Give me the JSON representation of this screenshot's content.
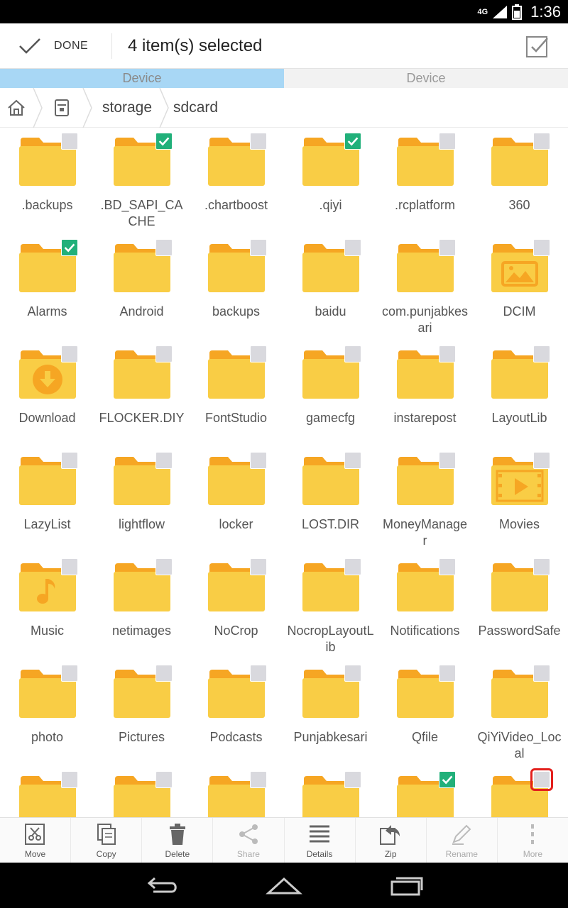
{
  "status": {
    "network": "4G",
    "time": "1:36"
  },
  "actionbar": {
    "done_label": "DONE",
    "title": "4 item(s) selected"
  },
  "tabs": [
    {
      "label": "Device",
      "active": true
    },
    {
      "label": "Device",
      "active": false
    }
  ],
  "breadcrumb": {
    "storage": "storage",
    "sdcard": "sdcard"
  },
  "files": [
    {
      "name": ".backups",
      "checked": false,
      "icon": "folder"
    },
    {
      "name": ".BD_SAPI_CACHE",
      "checked": true,
      "icon": "folder"
    },
    {
      "name": ".chartboost",
      "checked": false,
      "icon": "folder"
    },
    {
      "name": ".qiyi",
      "checked": true,
      "icon": "folder"
    },
    {
      "name": ".rcplatform",
      "checked": false,
      "icon": "folder"
    },
    {
      "name": "360",
      "checked": false,
      "icon": "folder"
    },
    {
      "name": "Alarms",
      "checked": true,
      "icon": "folder"
    },
    {
      "name": "Android",
      "checked": false,
      "icon": "folder"
    },
    {
      "name": "backups",
      "checked": false,
      "icon": "folder"
    },
    {
      "name": "baidu",
      "checked": false,
      "icon": "folder"
    },
    {
      "name": "com.punjabkesari",
      "checked": false,
      "icon": "folder"
    },
    {
      "name": "DCIM",
      "checked": false,
      "icon": "image-folder"
    },
    {
      "name": "Download",
      "checked": false,
      "icon": "download-folder"
    },
    {
      "name": "FLOCKER.DIY",
      "checked": false,
      "icon": "folder"
    },
    {
      "name": "FontStudio",
      "checked": false,
      "icon": "folder"
    },
    {
      "name": "gamecfg",
      "checked": false,
      "icon": "folder"
    },
    {
      "name": "instarepost",
      "checked": false,
      "icon": "folder"
    },
    {
      "name": "LayoutLib",
      "checked": false,
      "icon": "folder"
    },
    {
      "name": "LazyList",
      "checked": false,
      "icon": "folder"
    },
    {
      "name": "lightflow",
      "checked": false,
      "icon": "folder"
    },
    {
      "name": "locker",
      "checked": false,
      "icon": "folder"
    },
    {
      "name": "LOST.DIR",
      "checked": false,
      "icon": "folder"
    },
    {
      "name": "MoneyManager",
      "checked": false,
      "icon": "folder"
    },
    {
      "name": "Movies",
      "checked": false,
      "icon": "video-folder"
    },
    {
      "name": "Music",
      "checked": false,
      "icon": "music-folder"
    },
    {
      "name": "netimages",
      "checked": false,
      "icon": "folder"
    },
    {
      "name": "NoCrop",
      "checked": false,
      "icon": "folder"
    },
    {
      "name": "NocropLayoutLib",
      "checked": false,
      "icon": "folder"
    },
    {
      "name": "Notifications",
      "checked": false,
      "icon": "folder"
    },
    {
      "name": "PasswordSafe",
      "checked": false,
      "icon": "folder"
    },
    {
      "name": "photo",
      "checked": false,
      "icon": "folder"
    },
    {
      "name": "Pictures",
      "checked": false,
      "icon": "folder"
    },
    {
      "name": "Podcasts",
      "checked": false,
      "icon": "folder"
    },
    {
      "name": "Punjabkesari",
      "checked": false,
      "icon": "folder"
    },
    {
      "name": "Qfile",
      "checked": false,
      "icon": "folder"
    },
    {
      "name": "QiYiVideo_Local",
      "checked": false,
      "icon": "folder"
    },
    {
      "name": "",
      "checked": false,
      "icon": "folder"
    },
    {
      "name": "",
      "checked": false,
      "icon": "folder"
    },
    {
      "name": "",
      "checked": false,
      "icon": "folder"
    },
    {
      "name": "",
      "checked": false,
      "icon": "folder"
    },
    {
      "name": "",
      "checked": true,
      "icon": "folder"
    },
    {
      "name": "",
      "checked": false,
      "icon": "folder",
      "highlighted": true
    }
  ],
  "toolbar": [
    {
      "label": "Move",
      "icon": "move-icon",
      "enabled": true
    },
    {
      "label": "Copy",
      "icon": "copy-icon",
      "enabled": true
    },
    {
      "label": "Delete",
      "icon": "delete-icon",
      "enabled": true
    },
    {
      "label": "Share",
      "icon": "share-icon",
      "enabled": false
    },
    {
      "label": "Details",
      "icon": "details-icon",
      "enabled": true
    },
    {
      "label": "Zip",
      "icon": "zip-icon",
      "enabled": true
    },
    {
      "label": "Rename",
      "icon": "rename-icon",
      "enabled": false
    },
    {
      "label": "More",
      "icon": "more-icon",
      "enabled": false
    }
  ],
  "colors": {
    "folder": "#f9cd45",
    "folder_tab": "#f6a623",
    "checked": "#21b07a",
    "tab_active": "#a8d7f5",
    "highlight": "#e3201d"
  }
}
